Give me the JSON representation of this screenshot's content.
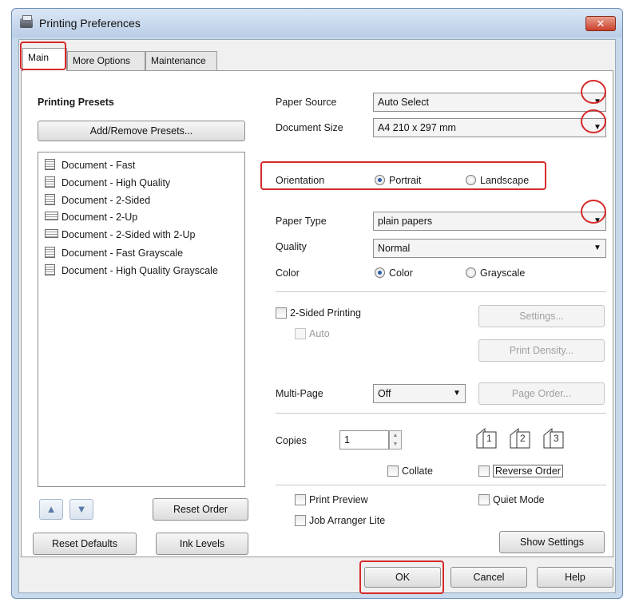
{
  "window": {
    "title": "Printing Preferences",
    "close_glyph": "✕"
  },
  "tabs": [
    {
      "label": "Main",
      "active": true
    },
    {
      "label": "More Options",
      "active": false
    },
    {
      "label": "Maintenance",
      "active": false
    }
  ],
  "presets": {
    "heading": "Printing Presets",
    "add_remove_label": "Add/Remove Presets...",
    "items": [
      "Document - Fast",
      "Document - High Quality",
      "Document - 2-Sided",
      "Document - 2-Up",
      "Document - 2-Sided with 2-Up",
      "Document - Fast Grayscale",
      "Document - High Quality Grayscale"
    ],
    "up_glyph": "▲",
    "down_glyph": "▼",
    "reset_order_label": "Reset Order"
  },
  "paper_source": {
    "label": "Paper Source",
    "value": "Auto Select"
  },
  "document_size": {
    "label": "Document Size",
    "value": "A4 210 x 297 mm"
  },
  "orientation": {
    "label": "Orientation",
    "portrait": "Portrait",
    "landscape": "Landscape",
    "selected": "Portrait"
  },
  "paper_type": {
    "label": "Paper Type",
    "value": "plain papers"
  },
  "quality": {
    "label": "Quality",
    "value": "Normal"
  },
  "color": {
    "label": "Color",
    "color_option": "Color",
    "grayscale_option": "Grayscale",
    "selected": "Color"
  },
  "two_sided": {
    "label": "2-Sided Printing",
    "auto_label": "Auto",
    "settings_label": "Settings...",
    "print_density_label": "Print Density..."
  },
  "multi_page": {
    "label": "Multi-Page",
    "value": "Off",
    "page_order_label": "Page Order..."
  },
  "copies": {
    "label": "Copies",
    "value": "1",
    "collate_label": "Collate",
    "reverse_order_label": "Reverse Order",
    "collate_icon_labels": [
      "1",
      "2",
      "3"
    ]
  },
  "options": {
    "print_preview_label": "Print Preview",
    "quiet_mode_label": "Quiet Mode",
    "job_arranger_label": "Job Arranger Lite",
    "show_settings_label": "Show Settings"
  },
  "bottom": {
    "reset_defaults_label": "Reset Defaults",
    "ink_levels_label": "Ink Levels"
  },
  "dialog": {
    "ok_label": "OK",
    "cancel_label": "Cancel",
    "help_label": "Help"
  },
  "colors": {
    "highlight": "#d62a2a",
    "radio_selected": "#2b5fa8",
    "titlebar": "#c9d9ec",
    "close_button": "#c9402a"
  }
}
